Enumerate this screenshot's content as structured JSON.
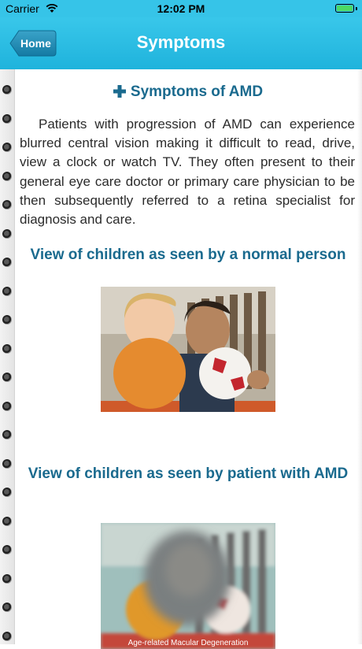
{
  "status_bar": {
    "carrier": "Carrier",
    "time": "12:02 PM"
  },
  "nav": {
    "back_label": "Home",
    "title": "Symptoms"
  },
  "content": {
    "heading": "Symptoms of AMD",
    "paragraph": "Patients with progression of AMD can experience blurred central vision making it difficult to read, drive, view a clock or watch TV. They often present to their general eye care doctor or primary care physician to be then subsequently referred to a retina specialist for diagnosis and care.",
    "caption_normal": "View of children as seen by a normal person",
    "caption_patient": "View of children as seen by patient with AMD",
    "image_note": "Age-related Macular Degeneration"
  },
  "icons": {
    "wifi": "wifi-icon",
    "battery": "battery-icon",
    "back": "back-arrow-icon",
    "heading": "plus-cross-icon",
    "binding": "spiral-ring-icon"
  },
  "colors": {
    "nav_bar": "#1fb3dc",
    "heading_text": "#1a6a8e",
    "body_text": "#2b2b2b",
    "battery_fill": "#4cd964"
  }
}
